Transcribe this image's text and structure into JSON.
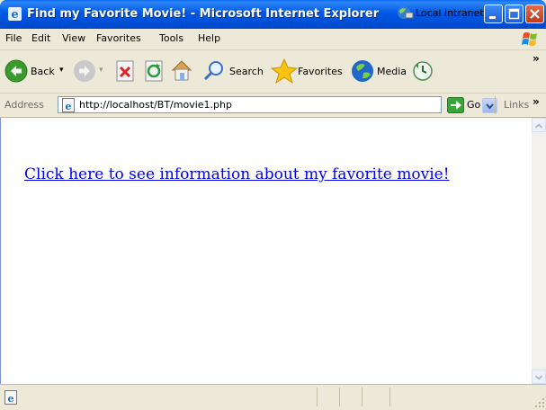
{
  "window": {
    "title": "Find my Favorite Movie! - Microsoft Internet Explorer",
    "accent_color": "#0054e3",
    "close_color": "#d0502b"
  },
  "menu": {
    "items": [
      "File",
      "Edit",
      "View",
      "Favorites",
      "Tools",
      "Help"
    ]
  },
  "toolbar": {
    "back_label": "Back",
    "search_label": "Search",
    "favorites_label": "Favorites",
    "media_label": "Media",
    "overflow": "»"
  },
  "address": {
    "label": "Address",
    "url": "http://localhost/BT/movie1.php",
    "go_label": "Go",
    "links_label": "Links",
    "links_overflow": "»"
  },
  "page": {
    "link_text": "Click here to see information about my favorite movie!",
    "link_color": "#0000ee"
  },
  "status": {
    "zone": "Local intranet"
  },
  "icons": [
    "ie-icon",
    "minimize-icon",
    "maximize-icon",
    "close-icon",
    "windows-logo-icon",
    "back-arrow-icon",
    "forward-arrow-icon",
    "stop-icon",
    "refresh-icon",
    "home-icon",
    "search-icon",
    "favorites-star-icon",
    "media-icon",
    "history-icon",
    "page-icon",
    "dropdown-arrow-icon",
    "go-arrow-icon",
    "local-intranet-icon"
  ]
}
